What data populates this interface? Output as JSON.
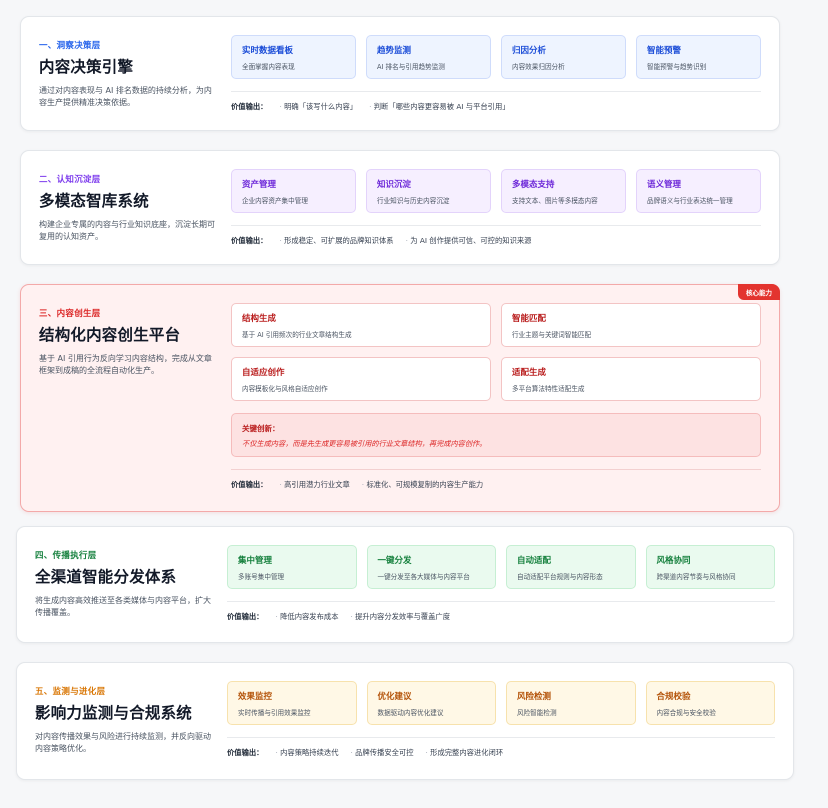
{
  "layers": [
    {
      "tag": "一、洞察决策层",
      "title": "内容决策引擎",
      "desc": "通过对内容表现与 AI 排名数据的持续分析，为内容生产提供精准决策依据。",
      "color": "#2563eb",
      "card_bg": "#eef4ff",
      "card_border": "#cfdcfb",
      "cards": [
        {
          "title": "实时数据看板",
          "sub": "全面掌握内容表现"
        },
        {
          "title": "趋势监测",
          "sub": "AI 排名与引用趋势监测"
        },
        {
          "title": "归因分析",
          "sub": "内容效果归因分析"
        },
        {
          "title": "智能预警",
          "sub": "智能预警与趋势识别"
        }
      ],
      "value_label": "价值输出：",
      "values": [
        "明确「该写什么内容」",
        "判断「哪些内容更容易被 AI 与平台引用」"
      ]
    },
    {
      "tag": "二、认知沉淀层",
      "title": "多模态智库系统",
      "desc": "构建企业专属的内容与行业知识底座，沉淀长期可复用的认知资产。",
      "color": "#7c3aed",
      "card_bg": "#f6efff",
      "card_border": "#e3d3fb",
      "cards": [
        {
          "title": "资产管理",
          "sub": "企业内容资产集中管理"
        },
        {
          "title": "知识沉淀",
          "sub": "行业知识与历史内容沉淀"
        },
        {
          "title": "多模态支持",
          "sub": "支持文本、图片等多模态内容"
        },
        {
          "title": "语义管理",
          "sub": "品牌语义与行业表达统一管理"
        }
      ],
      "value_label": "价值输出：",
      "values": [
        "形成稳定、可扩展的品牌知识体系",
        "为 AI 创作提供可信、可控的知识来源"
      ]
    },
    {
      "tag": "三、内容创生层",
      "title": "结构化内容创生平台",
      "desc": "基于 AI 引用行为反向学习内容结构，完成从文章框架到成稿的全流程自动化生产。",
      "color": "#dc2626",
      "badge": "核心能力",
      "cards": [
        {
          "title": "结构生成",
          "sub": "基于 AI 引用频次的行业文章结构生成"
        },
        {
          "title": "智能匹配",
          "sub": "行业主题与关键词智能匹配"
        },
        {
          "title": "自适应创作",
          "sub": "内容模板化与风格自适应创作"
        },
        {
          "title": "适配生成",
          "sub": "多平台算法特性适配生成"
        }
      ],
      "innov_label": "关键创新：",
      "innov_text": "不仅生成内容，而是先生成更容易被引用的行业文章结构，再完成内容创作。",
      "value_label": "价值输出：",
      "values": [
        "高引用潜力行业文章",
        "标准化、可规模复制的内容生产能力"
      ]
    },
    {
      "tag": "四、传播执行层",
      "title": "全渠道智能分发体系",
      "desc": "将生成内容高效推送至各类媒体与内容平台，扩大传播覆盖。",
      "color": "#15803d",
      "card_bg": "#eafaef",
      "card_border": "#c6efd3",
      "cards": [
        {
          "title": "集中管理",
          "sub": "多账号集中管理"
        },
        {
          "title": "一键分发",
          "sub": "一键分发至各大媒体与内容平台"
        },
        {
          "title": "自动适配",
          "sub": "自动适配平台规则与内容形态"
        },
        {
          "title": "风格协同",
          "sub": "跨渠道内容节奏与风格协同"
        }
      ],
      "value_label": "价值输出：",
      "values": [
        "降低内容发布成本",
        "提升内容分发效率与覆盖广度"
      ]
    },
    {
      "tag": "五、监测与进化层",
      "title": "影响力监测与合规系统",
      "desc": "对内容传播效果与风险进行持续监测，并反向驱动内容策略优化。",
      "color": "#d97706",
      "card_bg": "#fff8e6",
      "card_border": "#f7e2ad",
      "cards": [
        {
          "title": "效果监控",
          "sub": "实时传播与引用效果监控"
        },
        {
          "title": "优化建议",
          "sub": "数据驱动内容优化建议"
        },
        {
          "title": "风险检测",
          "sub": "风险智能检测"
        },
        {
          "title": "合规校验",
          "sub": "内容合规与安全校验"
        }
      ],
      "value_label": "价值输出：",
      "values": [
        "内容策略持续迭代",
        "品牌传播安全可控",
        "形成完整内容进化闭环"
      ]
    }
  ]
}
